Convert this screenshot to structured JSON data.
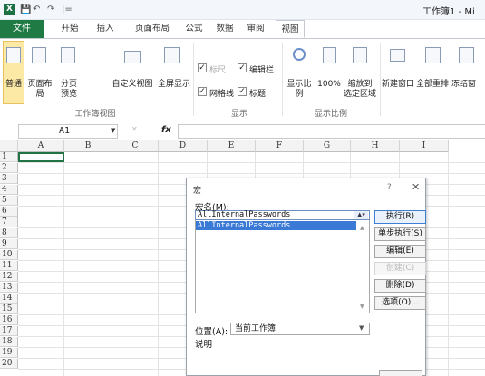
{
  "window": {
    "app_icon": "X",
    "title": "工作簿1 - Mi"
  },
  "quick_access": [
    "💾",
    "↶",
    "↷",
    "|="
  ],
  "tabs": [
    {
      "label": "文件"
    },
    {
      "label": "开始"
    },
    {
      "label": "插入"
    },
    {
      "label": "页面布局"
    },
    {
      "label": "公式"
    },
    {
      "label": "数据"
    },
    {
      "label": "审阅"
    },
    {
      "label": "视图"
    }
  ],
  "ribbon": {
    "workbook_views": {
      "normal": "普通",
      "page_layout": "页面布局",
      "page_break_1": "分页",
      "page_break_2": "预览",
      "custom_views": "自定义视图",
      "full_screen": "全屏显示",
      "group_label": "工作簿视图"
    },
    "show": {
      "ruler": "标尺",
      "formula_bar": "编辑栏",
      "gridlines": "网格线",
      "headings": "标题",
      "group_label": "显示"
    },
    "zoom": {
      "zoom": "显示比例",
      "hundred": "100%",
      "zoom_selection_1": "缩放到",
      "zoom_selection_2": "选定区域",
      "group_label": "显示比例"
    },
    "window": {
      "new_window": "新建窗口",
      "arrange_all": "全部重排",
      "freeze": "冻结窗"
    }
  },
  "formula_bar": {
    "name_box": "A1",
    "fx": "fx"
  },
  "grid": {
    "columns": [
      "A",
      "B",
      "C",
      "D",
      "E",
      "F",
      "G",
      "H",
      "I"
    ],
    "rows": [
      "1",
      "2",
      "3",
      "4",
      "5",
      "6",
      "7",
      "8",
      "9",
      "10",
      "11",
      "12",
      "13",
      "14",
      "15",
      "16",
      "17",
      "18",
      "19",
      "20"
    ]
  },
  "dialog": {
    "title": "宏",
    "help": "?",
    "close": "✕",
    "macro_name_label": "宏名(M):",
    "macro_name_value": "AllInternalPasswords",
    "macro_list": [
      "AllInternalPasswords"
    ],
    "buttons": {
      "run": "执行(R)",
      "step_into": "单步执行(S)",
      "edit": "编辑(E)",
      "create": "创建(C)",
      "delete": "删除(D)",
      "options": "选项(O)..."
    },
    "location_label": "位置(A):",
    "location_value": "当前工作簿",
    "description_label": "说明"
  }
}
